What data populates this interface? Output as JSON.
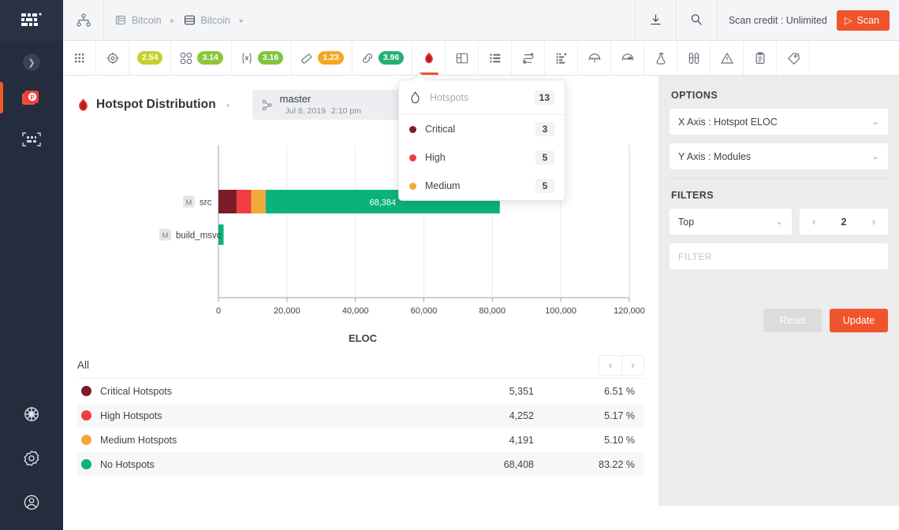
{
  "rail": {
    "logo": "logo-icon",
    "collapse": "chevron-right-icon",
    "items": [
      {
        "icon": "camera-hotspot-icon",
        "active": true
      },
      {
        "icon": "scan-frame-icon",
        "active": false
      }
    ],
    "bottom": [
      {
        "icon": "globe-icon"
      },
      {
        "icon": "settings-gear-icon"
      },
      {
        "icon": "user-account-icon"
      }
    ]
  },
  "topbar": {
    "hierarchy_icon": "sitemap-icon",
    "breadcrumb": [
      {
        "icon": "project-icon",
        "label": "Bitcoin"
      },
      {
        "icon": "database-icon",
        "label": "Bitcoin"
      }
    ],
    "download_icon": "download-icon",
    "search_icon": "search-icon",
    "scan_credit": "Scan credit : Unlimited",
    "scan_button": "Scan"
  },
  "toolbar": {
    "tools": [
      {
        "icon": "grid-dots-icon",
        "badge": null,
        "active": false
      },
      {
        "icon": "target-icon",
        "badge": null,
        "active": false
      },
      {
        "icon": "badge-only",
        "badge": "2.54",
        "badge_color": "#c3d12b",
        "active": false
      },
      {
        "icon": "four-squares-icon",
        "badge": "3.14",
        "badge_color": "#8cc63e",
        "active": false
      },
      {
        "icon": "variable-x-icon",
        "badge": "3.16",
        "badge_color": "#82c341",
        "active": false
      },
      {
        "icon": "eraser-icon",
        "badge": "1.23",
        "badge_color": "#f5a623",
        "active": false
      },
      {
        "icon": "link-chain-icon",
        "badge": "3.96",
        "badge_color": "#24b072",
        "active": false
      },
      {
        "icon": "flame-hotspot-icon",
        "badge": null,
        "active": true
      },
      {
        "icon": "layout-panel-icon",
        "badge": null,
        "active": false
      },
      {
        "icon": "list-bullets-icon",
        "badge": null,
        "active": false
      },
      {
        "icon": "flow-arrow-icon",
        "badge": null,
        "active": false
      },
      {
        "icon": "matrix-grid-icon",
        "badge": null,
        "active": false
      },
      {
        "icon": "umbrella-icon",
        "badge": null,
        "active": false
      },
      {
        "icon": "umbrella-lock-icon",
        "badge": null,
        "active": false
      },
      {
        "icon": "flask-icon",
        "badge": null,
        "active": false
      },
      {
        "icon": "test-tubes-icon",
        "badge": null,
        "active": false
      },
      {
        "icon": "warning-triangle-icon",
        "badge": null,
        "active": false
      },
      {
        "icon": "clipboard-icon",
        "badge": null,
        "active": false
      },
      {
        "icon": "tag-icon",
        "badge": null,
        "active": false
      }
    ]
  },
  "chart_header": {
    "flame_icon": "flame-hotspot-icon",
    "title": "Hotspot Distribution",
    "branch_icon": "branch-icon",
    "branch_name": "master",
    "branch_date": "Jul 8, 2019",
    "branch_time": "2:10 pm",
    "caret": "chevron-down-icon"
  },
  "popup": {
    "icon": "flame-outline-icon",
    "header_label": "Hotspots",
    "header_count": "13",
    "rows": [
      {
        "label": "Critical",
        "count": "3",
        "color": "#7b1c27"
      },
      {
        "label": "High",
        "count": "5",
        "color": "#ee3e42"
      },
      {
        "label": "Medium",
        "count": "5",
        "color": "#f2a93b"
      }
    ]
  },
  "chart_data": {
    "type": "bar",
    "orientation": "horizontal",
    "stacked": true,
    "title": "Hotspot Distribution",
    "xlabel": "ELOC",
    "ylabel": "",
    "categories": [
      "src",
      "build_msvc"
    ],
    "category_badge": "M",
    "xlim": [
      0,
      120000
    ],
    "xticks": [
      0,
      20000,
      40000,
      60000,
      80000,
      100000,
      120000
    ],
    "xticklabels": [
      "0",
      "20,000",
      "40,000",
      "60,000",
      "80,000",
      "100,000",
      "120,000"
    ],
    "grid": true,
    "series": [
      {
        "name": "Critical Hotspots",
        "color": "#7b1c27",
        "values": [
          5351,
          0
        ]
      },
      {
        "name": "High Hotspots",
        "color": "#ee3e42",
        "values": [
          4252,
          0
        ]
      },
      {
        "name": "Medium Hotspots",
        "color": "#f2a93b",
        "values": [
          4191,
          0
        ]
      },
      {
        "name": "No Hotspots",
        "color": "#0bb37c",
        "values": [
          68384,
          1500
        ]
      }
    ],
    "bar_labels": [
      {
        "category": "src",
        "label": "68,384"
      }
    ]
  },
  "table": {
    "header_label": "All",
    "prev_icon": "chevron-left-icon",
    "next_icon": "chevron-right-icon",
    "rows": [
      {
        "name": "Critical Hotspots",
        "value": "5,351",
        "pct": "6.51 %",
        "color": "#7b1c27"
      },
      {
        "name": "High Hotspots",
        "value": "4,252",
        "pct": "5.17 %",
        "color": "#ee3e42"
      },
      {
        "name": "Medium Hotspots",
        "value": "4,191",
        "pct": "5.10 %",
        "color": "#f2a93b"
      },
      {
        "name": "No Hotspots",
        "value": "68,408",
        "pct": "83.22 %",
        "color": "#0bb37c"
      }
    ]
  },
  "options": {
    "options_title": "OPTIONS",
    "x_axis": "X Axis : Hotspot ELOC",
    "y_axis": "Y Axis : Modules",
    "filters_title": "FILTERS",
    "filter_mode": "Top",
    "filter_count": "2",
    "filter_placeholder": "FILTER",
    "reset_label": "Reset",
    "update_label": "Update"
  }
}
